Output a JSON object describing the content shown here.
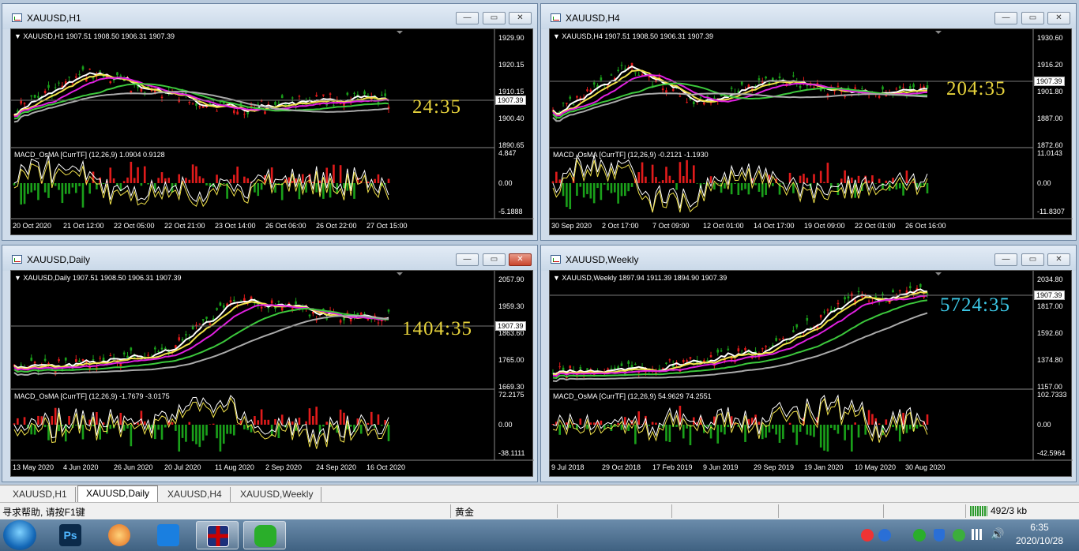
{
  "windows": [
    {
      "title": "XAUUSD,H1",
      "info": "XAUUSD,H1  1907.51 1908.50 1906.31 1907.39",
      "prices": [
        "1929.90",
        "1920.15",
        "1910.15",
        "1900.40",
        "1890.65"
      ],
      "current": "1907.39",
      "timer": "24:35",
      "macd_label": "MACD_OsMA [CurrTF] (12,26,9) 1.0904 0.9128",
      "macd_axis": [
        "4.847",
        "0.00",
        "-5.1888"
      ],
      "dates": [
        "20 Oct 2020",
        "21 Oct 12:00",
        "22 Oct 05:00",
        "22 Oct 21:00",
        "23 Oct 14:00",
        "26 Oct 06:00",
        "26 Oct 22:00",
        "27 Oct 15:00"
      ]
    },
    {
      "title": "XAUUSD,H4",
      "info": "XAUUSD,H4  1907.51 1908.50 1906.31 1907.39",
      "prices": [
        "1930.60",
        "1916.20",
        "1901.80",
        "1887.00",
        "1872.60"
      ],
      "current": "1907.39",
      "timer": "204:35",
      "macd_label": "MACD_OsMA [CurrTF] (12,26,9) -0.2121 -1.1930",
      "macd_axis": [
        "11.0143",
        "0.00",
        "-11.8307"
      ],
      "dates": [
        "30 Sep 2020",
        "2 Oct 17:00",
        "7 Oct 09:00",
        "12 Oct 01:00",
        "14 Oct 17:00",
        "19 Oct 09:00",
        "22 Oct 01:00",
        "26 Oct 16:00"
      ]
    },
    {
      "title": "XAUUSD,Daily",
      "info": "XAUUSD,Daily  1907.51 1908.50 1906.31 1907.39",
      "prices": [
        "2057.90",
        "1959.30",
        "1863.60",
        "1765.00",
        "1669.30"
      ],
      "current": "1907.39",
      "timer": "1404:35",
      "macd_label": "MACD_OsMA [CurrTF] (12,26,9) -1.7679 -3.0175",
      "macd_axis": [
        "72.2175",
        "0.00",
        "-38.1111"
      ],
      "dates": [
        "13 May 2020",
        "4 Jun 2020",
        "26 Jun 2020",
        "20 Jul 2020",
        "11 Aug 2020",
        "2 Sep 2020",
        "24 Sep 2020",
        "16 Oct 2020"
      ]
    },
    {
      "title": "XAUUSD,Weekly",
      "info": "XAUUSD,Weekly  1897.94 1911.39 1894.90 1907.39",
      "prices": [
        "2034.80",
        "1817.00",
        "1592.60",
        "1374.80",
        "1157.00"
      ],
      "current": "1907.39",
      "timer": "5724:35",
      "macd_label": "MACD_OsMA [CurrTF] (12,26,9) 54.9629 74.2551",
      "macd_axis": [
        "102.7333",
        "0.00",
        "-42.5964"
      ],
      "dates": [
        "9 Jul 2018",
        "29 Oct 2018",
        "17 Feb 2019",
        "9 Jun 2019",
        "29 Sep 2019",
        "19 Jan 2020",
        "10 May 2020",
        "30 Aug 2020"
      ]
    }
  ],
  "tabs": [
    "XAUUSD,H1",
    "XAUUSD,Daily",
    "XAUUSD,H4",
    "XAUUSD,Weekly"
  ],
  "status": {
    "help": "寻求帮助, 请按F1键",
    "symbol": "黄金",
    "traffic": "492/3 kb"
  },
  "clock": {
    "time": "6:35",
    "date": "2020/10/28"
  },
  "taskbar": {
    "ps": "Ps"
  },
  "colors": {
    "bull": "#e01b1b",
    "bear": "#1aa01a",
    "ma_white": "#ffffff",
    "ma_yellow": "#f1e24a",
    "ma_magenta": "#e020e0",
    "ma_green": "#3cc83c",
    "ma_gray": "#aaaaaa",
    "timer_h1": "#e6d23c",
    "timer_weekly": "#3cc8e6"
  }
}
